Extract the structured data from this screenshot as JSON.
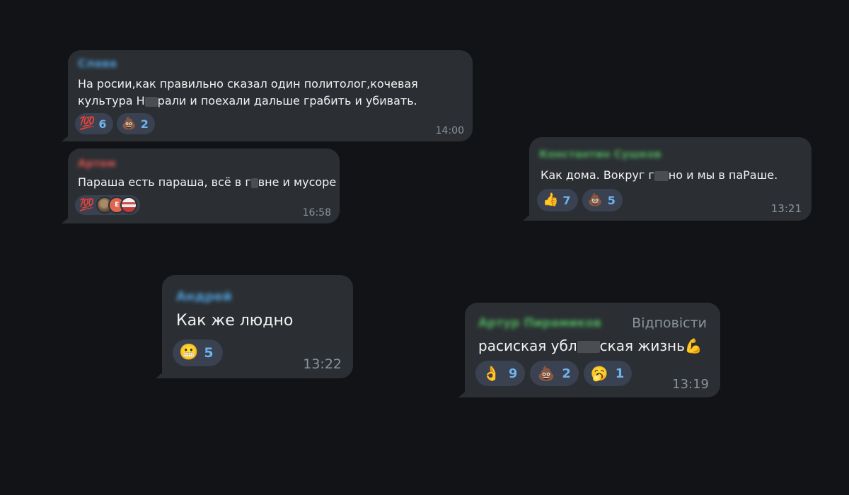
{
  "colors": {
    "background": "#121317",
    "bubble": "#2b2f33",
    "text": "#f2f2f2",
    "time": "#8b939b",
    "reaction_bg": "#3a4150",
    "reaction_count": "#6fb3ee",
    "sender_blue": "#4f9bd4",
    "sender_red": "#d3524f",
    "sender_green": "#4fae5c",
    "reply_label": "#8b939b"
  },
  "messages": [
    {
      "sender": "Слава",
      "text_line1": "На росии,как правильно сказал один политолог,кочевая",
      "text_line2_a": "культура Н",
      "text_line2_b": "рали и поехали дальше грабить и убивать.",
      "reactions": [
        {
          "icon": "hundred-points-emoji",
          "glyph": "💯",
          "count": "6"
        },
        {
          "icon": "pile-of-poo-emoji",
          "glyph": "💩",
          "count": "2"
        }
      ],
      "time": "14:00"
    },
    {
      "sender": "Артем",
      "text_a": "Параша есть параша, всё в г",
      "text_b": "вне и мусоре",
      "reaction_glyph": "💯",
      "reaction_icon": "hundred-points-emoji",
      "avatar_letter": "E",
      "time": "16:58"
    },
    {
      "sender": "Константин Сушков",
      "text_a": "Как дома. Вокруг г",
      "text_b": "но и мы в паРаше.",
      "reactions": [
        {
          "icon": "thumbs-up-emoji",
          "glyph": "👍",
          "count": "7"
        },
        {
          "icon": "pile-of-poo-emoji",
          "glyph": "💩",
          "count": "5"
        }
      ],
      "time": "13:21"
    },
    {
      "sender": "Андрей",
      "text": "Как же людно",
      "reactions": [
        {
          "icon": "grimacing-face-emoji",
          "glyph": "😬",
          "count": "5"
        }
      ],
      "time": "13:22"
    },
    {
      "sender": "Артур Пирамиков",
      "reply_label": "Відповісти",
      "text_a": "расиская убл",
      "text_b": "ская жизнь",
      "text_emoji": "💪",
      "reactions": [
        {
          "icon": "ok-hand-emoji",
          "glyph": "👌",
          "count": "9"
        },
        {
          "icon": "pile-of-poo-emoji",
          "glyph": "💩",
          "count": "2"
        },
        {
          "icon": "yawning-face-emoji",
          "glyph": "🥱",
          "count": "1"
        }
      ],
      "time": "13:19"
    }
  ]
}
